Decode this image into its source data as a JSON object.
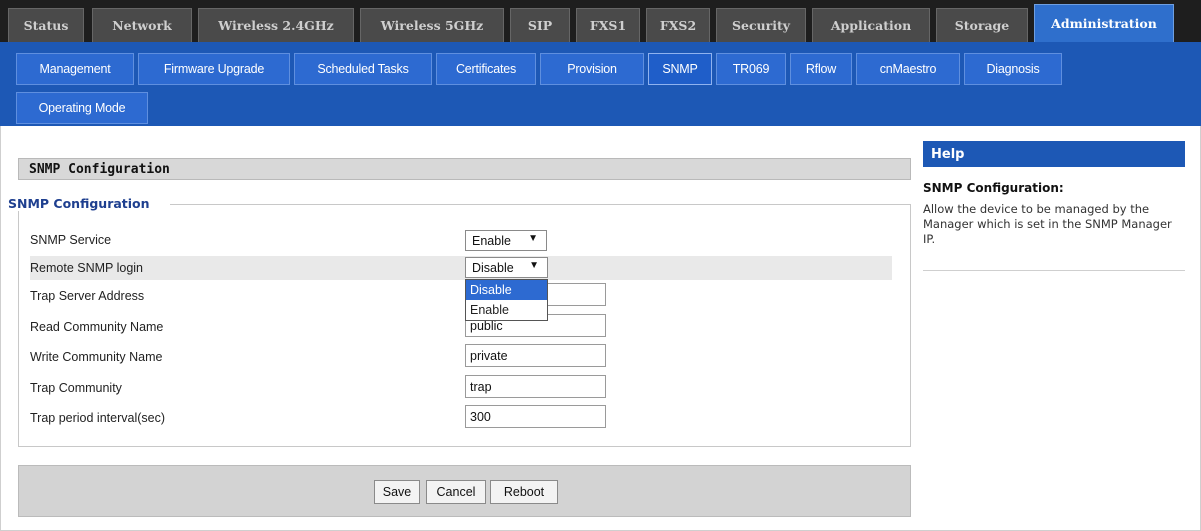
{
  "top_tabs": [
    "Status",
    "Network",
    "Wireless 2.4GHz",
    "Wireless 5GHz",
    "SIP",
    "FXS1",
    "FXS2",
    "Security",
    "Application",
    "Storage",
    "Administration"
  ],
  "sub_tabs": [
    "Management",
    "Firmware Upgrade",
    "Scheduled Tasks",
    "Certificates",
    "Provision",
    "SNMP",
    "TR069",
    "Rflow",
    "cnMaestro",
    "Diagnosis",
    "Operating Mode"
  ],
  "main": {
    "panel_title": "SNMP Configuration",
    "legend": "SNMP Configuration",
    "rows": [
      {
        "label": "SNMP Service",
        "value": "Enable"
      },
      {
        "label": "Remote SNMP login",
        "value": "Disable"
      },
      {
        "label": "Trap Server Address",
        "value": ""
      },
      {
        "label": "Read Community Name",
        "value": "public"
      },
      {
        "label": "Write Community Name",
        "value": "private"
      },
      {
        "label": "Trap Community",
        "value": "trap"
      },
      {
        "label": "Trap period interval(sec)",
        "value": "300"
      }
    ],
    "dropdown_options": [
      "Disable",
      "Enable"
    ],
    "dropdown_arrow": "▼"
  },
  "buttons": {
    "save": "Save",
    "cancel": "Cancel",
    "reboot": "Reboot"
  },
  "help": {
    "header": "Help",
    "title": "SNMP Configuration:",
    "text": "Allow the device to be managed by the Manager which is set in the SNMP Manager IP."
  },
  "colors": {
    "header_bg": "#1e1e1e",
    "subbar_bg": "#1d58b5",
    "active_tab": "#2f6fcc",
    "accent": "#2d6ad1"
  }
}
